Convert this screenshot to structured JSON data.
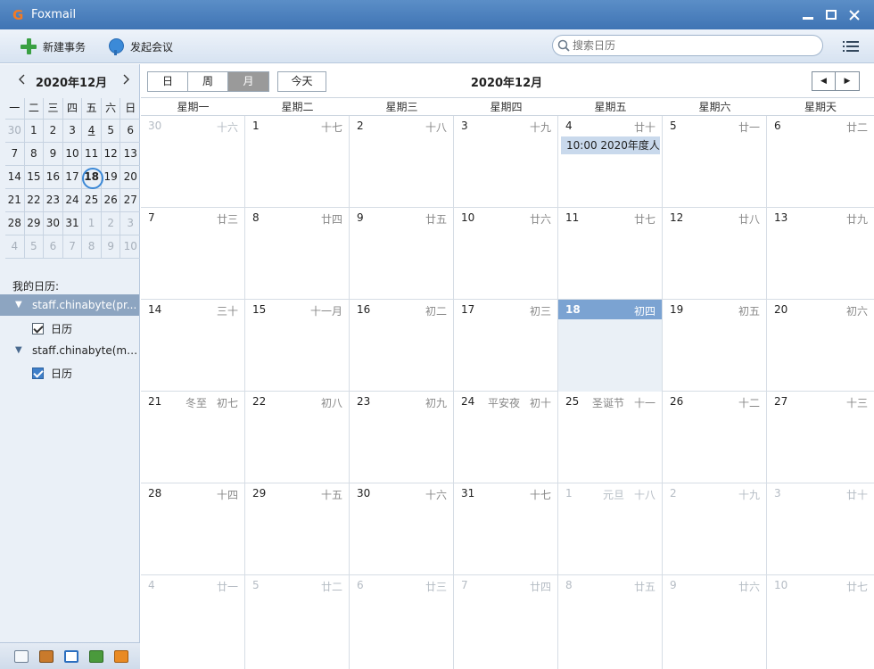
{
  "window": {
    "title": "Foxmail"
  },
  "toolbar": {
    "new_event": "新建事务",
    "start_meeting": "发起会议",
    "search_placeholder": "搜索日历"
  },
  "mini": {
    "title": "2020年12月",
    "weekdays": [
      "一",
      "二",
      "三",
      "四",
      "五",
      "六",
      "日"
    ],
    "weeks": [
      [
        "30",
        "1",
        "2",
        "3",
        "4",
        "5",
        "6"
      ],
      [
        "7",
        "8",
        "9",
        "10",
        "11",
        "12",
        "13"
      ],
      [
        "14",
        "15",
        "16",
        "17",
        "18",
        "19",
        "20"
      ],
      [
        "21",
        "22",
        "23",
        "24",
        "25",
        "26",
        "27"
      ],
      [
        "28",
        "29",
        "30",
        "31",
        "1",
        "2",
        "3"
      ],
      [
        "4",
        "5",
        "6",
        "7",
        "8",
        "9",
        "10"
      ]
    ]
  },
  "sidebar": {
    "my_calendars": "我的日历:",
    "accounts": [
      {
        "name": "staff.chinabyte(pr...",
        "calendar": "日历"
      },
      {
        "name": "staff.chinabyte(mi...",
        "calendar": "日历"
      }
    ]
  },
  "view": {
    "day": "日",
    "week": "周",
    "month": "月",
    "today": "今天",
    "title": "2020年12月"
  },
  "weekdays": [
    "星期一",
    "星期二",
    "星期三",
    "星期四",
    "星期五",
    "星期六",
    "星期天"
  ],
  "weeks": [
    [
      {
        "d": "30",
        "l": "十六"
      },
      {
        "d": "1",
        "l": "十七"
      },
      {
        "d": "2",
        "l": "十八"
      },
      {
        "d": "3",
        "l": "十九"
      },
      {
        "d": "4",
        "l": "廿十"
      },
      {
        "d": "5",
        "l": "廿一"
      },
      {
        "d": "6",
        "l": "廿二"
      }
    ],
    [
      {
        "d": "7",
        "l": "廿三"
      },
      {
        "d": "8",
        "l": "廿四"
      },
      {
        "d": "9",
        "l": "廿五"
      },
      {
        "d": "10",
        "l": "廿六"
      },
      {
        "d": "11",
        "l": "廿七"
      },
      {
        "d": "12",
        "l": "廿八"
      },
      {
        "d": "13",
        "l": "廿九"
      }
    ],
    [
      {
        "d": "14",
        "l": "三十"
      },
      {
        "d": "15",
        "l": "十一月"
      },
      {
        "d": "16",
        "l": "初二"
      },
      {
        "d": "17",
        "l": "初三"
      },
      {
        "d": "18",
        "l": "初四"
      },
      {
        "d": "19",
        "l": "初五"
      },
      {
        "d": "20",
        "l": "初六"
      }
    ],
    [
      {
        "d": "21",
        "l": "初七",
        "f": "冬至"
      },
      {
        "d": "22",
        "l": "初八"
      },
      {
        "d": "23",
        "l": "初九"
      },
      {
        "d": "24",
        "l": "初十",
        "f": "平安夜"
      },
      {
        "d": "25",
        "l": "十一",
        "f": "圣诞节"
      },
      {
        "d": "26",
        "l": "十二"
      },
      {
        "d": "27",
        "l": "十三"
      }
    ],
    [
      {
        "d": "28",
        "l": "十四"
      },
      {
        "d": "29",
        "l": "十五"
      },
      {
        "d": "30",
        "l": "十六"
      },
      {
        "d": "31",
        "l": "十七"
      },
      {
        "d": "1",
        "l": "十八",
        "f": "元旦"
      },
      {
        "d": "2",
        "l": "十九"
      },
      {
        "d": "3",
        "l": "廿十"
      }
    ],
    [
      {
        "d": "4",
        "l": "廿一"
      },
      {
        "d": "5",
        "l": "廿二"
      },
      {
        "d": "6",
        "l": "廿三"
      },
      {
        "d": "7",
        "l": "廿四"
      },
      {
        "d": "8",
        "l": "廿五"
      },
      {
        "d": "9",
        "l": "廿六"
      },
      {
        "d": "10",
        "l": "廿七"
      }
    ]
  ],
  "event": {
    "text": "10:00 2020年度人"
  },
  "colors": {
    "accent": "#7ba3d2",
    "titlebar": "#4a7fbe",
    "today_ring": "#3b88d6"
  }
}
